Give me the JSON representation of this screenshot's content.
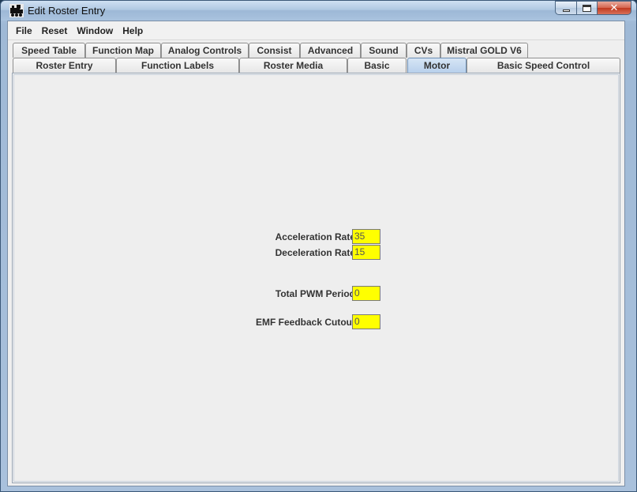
{
  "window": {
    "title": "Edit Roster Entry",
    "close_glyph": "✕",
    "app_icon": "locomotive-icon"
  },
  "menubar": {
    "items": [
      "File",
      "Reset",
      "Window",
      "Help"
    ]
  },
  "tabs": {
    "row_top": [
      "Speed Table",
      "Function Map",
      "Analog Controls",
      "Consist",
      "Advanced",
      "Sound",
      "CVs",
      "Mistral GOLD V6"
    ],
    "row_bottom": [
      "Roster Entry",
      "Function Labels",
      "Roster Media",
      "Basic",
      "Motor",
      "Basic Speed Control"
    ],
    "selected": "Motor"
  },
  "motor": {
    "acceleration_label": "Acceleration Rate",
    "acceleration_value": "35",
    "deceleration_label": "Deceleration Rate",
    "deceleration_value": "15",
    "pwm_label": "Total PWM Period",
    "pwm_value": "0",
    "emf_label": "EMF Feedback Cutout",
    "emf_value": "0"
  },
  "colors": {
    "field_background": "#ffff00",
    "selected_tab": "#b8d0ec"
  }
}
